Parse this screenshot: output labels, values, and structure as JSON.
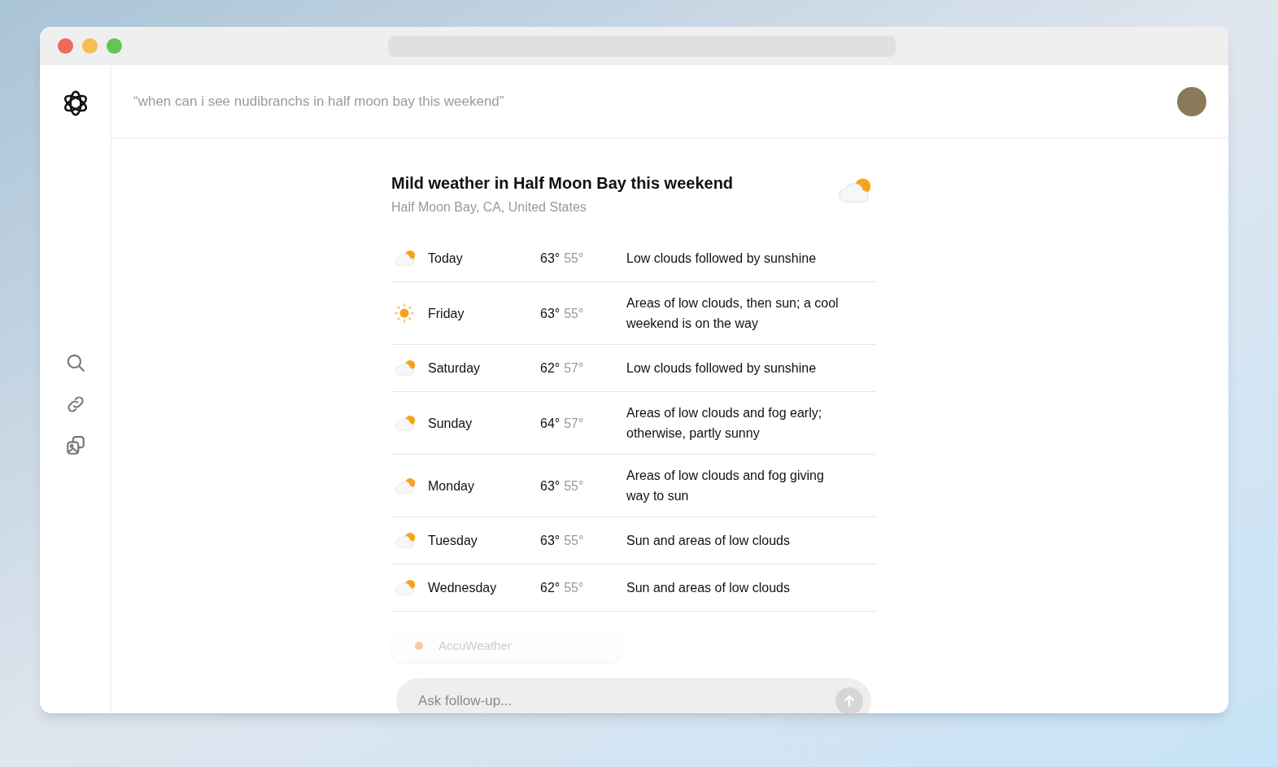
{
  "query": "“when can i see nudibranchs in half moon bay this weekend”",
  "weather": {
    "title": "Mild weather in Half Moon Bay this weekend",
    "location": "Half Moon Bay, CA, United States",
    "kind": "partly_cloudy",
    "days": [
      {
        "kind": "partly_cloudy",
        "day": "Today",
        "high": "63°",
        "low": "55°",
        "summary": "Low clouds followed by sunshine"
      },
      {
        "kind": "sunny",
        "day": "Friday",
        "high": "63°",
        "low": "55°",
        "summary": "Areas of low clouds, then sun; a cool weekend is on the way"
      },
      {
        "kind": "partly_cloudy",
        "day": "Saturday",
        "high": "62°",
        "low": "57°",
        "summary": "Low clouds followed by sunshine"
      },
      {
        "kind": "partly_cloudy",
        "day": "Sunday",
        "high": "64°",
        "low": "57°",
        "summary": "Areas of low clouds and fog early; otherwise, partly sunny"
      },
      {
        "kind": "partly_cloudy",
        "day": "Monday",
        "high": "63°",
        "low": "55°",
        "summary": "Areas of low clouds and fog giving way to sun"
      },
      {
        "kind": "partly_cloudy",
        "day": "Tuesday",
        "high": "63°",
        "low": "55°",
        "summary": "Sun and areas of low clouds"
      },
      {
        "kind": "partly_cloudy",
        "day": "Wednesday",
        "high": "62°",
        "low": "55°",
        "summary": "Sun and areas of low clouds"
      }
    ],
    "source": "AccuWeather"
  },
  "followup": {
    "placeholder": "Ask follow-up..."
  }
}
